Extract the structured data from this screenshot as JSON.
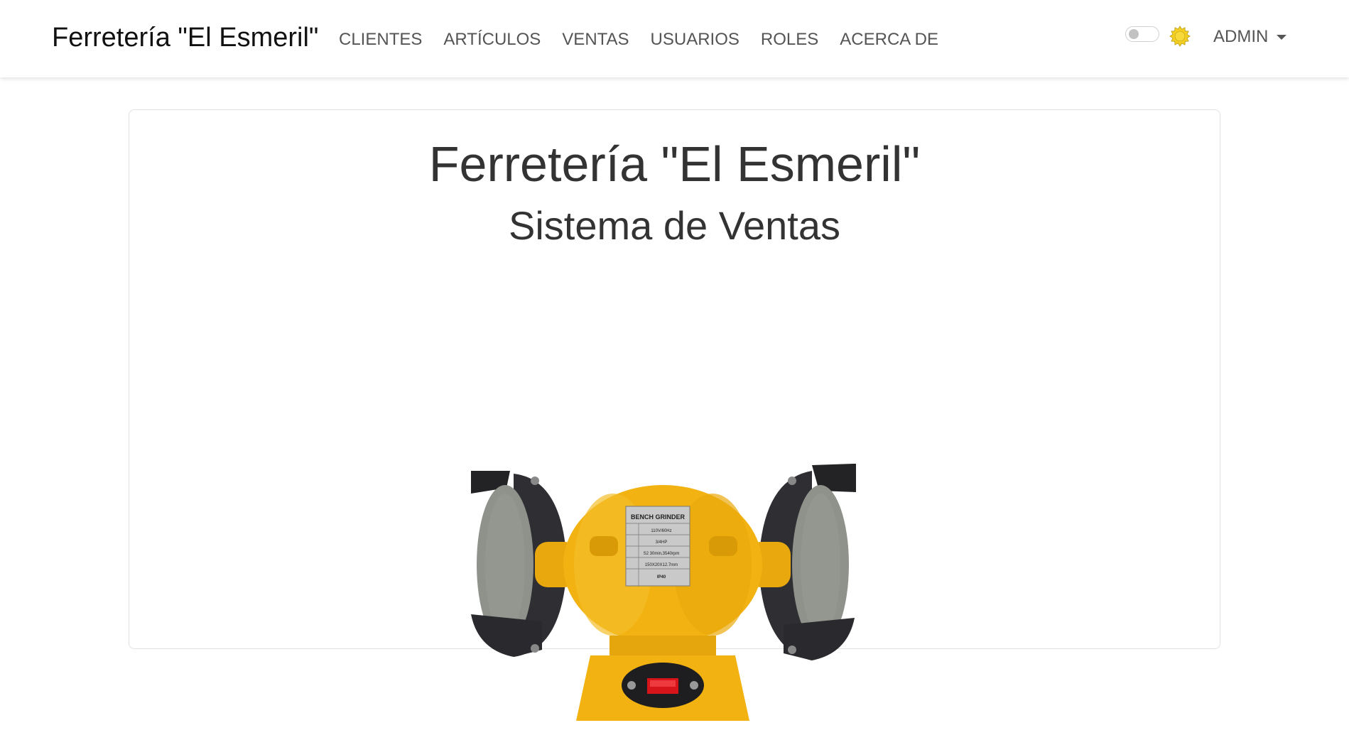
{
  "navbar": {
    "brand": "Ferretería \"El Esmeril\"",
    "links": [
      "CLIENTES",
      "ARTÍCULOS",
      "VENTAS",
      "USUARIOS",
      "ROLES",
      "ACERCA DE"
    ],
    "theme_toggle_on": false,
    "theme_icon": "sun-icon",
    "user_menu_label": "ADMIN"
  },
  "main": {
    "title": "Ferretería \"El Esmeril\"",
    "subtitle": "Sistema de Ventas",
    "image_label": {
      "header": "BENCH GRINDER",
      "rows": [
        "110V/60Hz",
        "3/4HP",
        "S2 30min,3540rpm",
        "150X20X12.7mm",
        "IP40"
      ]
    }
  },
  "colors": {
    "grinder_yellow": "#f2b312",
    "guard_dark": "#2a2a2e",
    "stone_grey": "#8e928a",
    "switch_red": "#d8141b",
    "sun_yellow": "#f5d020"
  }
}
